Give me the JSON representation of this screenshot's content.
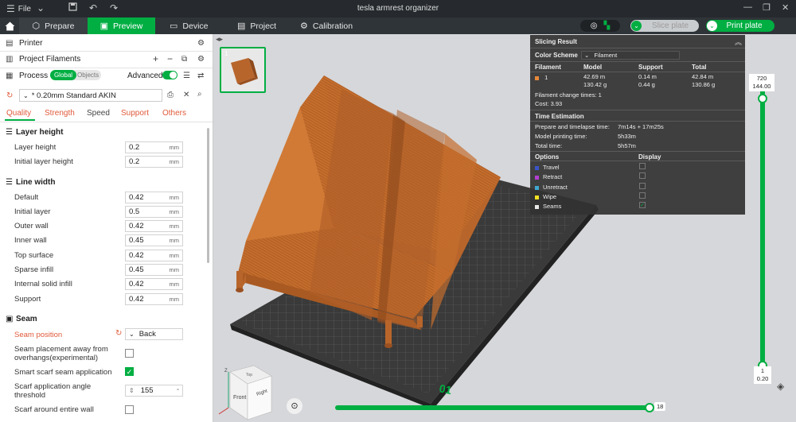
{
  "window": {
    "title": "tesla armrest organizer",
    "menu_label": "File"
  },
  "nav": {
    "tabs": [
      {
        "label": "Prepare"
      },
      {
        "label": "Preview"
      },
      {
        "label": "Device"
      },
      {
        "label": "Project"
      },
      {
        "label": "Calibration"
      }
    ],
    "slice_plate": "Slice plate",
    "print_plate": "Print plate"
  },
  "left": {
    "printer_label": "Printer",
    "project_filaments_label": "Project Filaments",
    "process_label": "Process",
    "global_label": "Global",
    "objects_label": "Objects",
    "advanced_label": "Advanced",
    "profile_name": "* 0.20mm Standard AKIN",
    "tabs": [
      "Quality",
      "Strength",
      "Speed",
      "Support",
      "Others"
    ],
    "layer_height": {
      "title": "Layer height",
      "rows": [
        {
          "label": "Layer height",
          "value": "0.2",
          "unit": "mm"
        },
        {
          "label": "Initial layer height",
          "value": "0.2",
          "unit": "mm"
        }
      ]
    },
    "line_width": {
      "title": "Line width",
      "rows": [
        {
          "label": "Default",
          "value": "0.42",
          "unit": "mm"
        },
        {
          "label": "Initial layer",
          "value": "0.5",
          "unit": "mm"
        },
        {
          "label": "Outer wall",
          "value": "0.42",
          "unit": "mm"
        },
        {
          "label": "Inner wall",
          "value": "0.45",
          "unit": "mm"
        },
        {
          "label": "Top surface",
          "value": "0.42",
          "unit": "mm"
        },
        {
          "label": "Sparse infill",
          "value": "0.45",
          "unit": "mm"
        },
        {
          "label": "Internal solid infill",
          "value": "0.42",
          "unit": "mm"
        },
        {
          "label": "Support",
          "value": "0.42",
          "unit": "mm"
        }
      ]
    },
    "seam": {
      "title": "Seam",
      "seam_position_label": "Seam position",
      "seam_position_value": "Back",
      "away_label_1": "Seam placement away from",
      "away_label_2": "overhangs(experimental)",
      "smart_scarf_label": "Smart scarf seam application",
      "scarf_angle_label_1": "Scarf application angle",
      "scarf_angle_label_2": "threshold",
      "scarf_angle_value": "155",
      "scarf_angle_unit": "°",
      "scarf_entire_label": "Scarf around entire wall"
    }
  },
  "plate": {
    "number": "1",
    "bed_label": "01"
  },
  "result": {
    "title": "Slicing Result",
    "color_scheme_label": "Color Scheme",
    "color_scheme_value": "Filament",
    "headers": {
      "filament": "Filament",
      "model": "Model",
      "support": "Support",
      "total": "Total"
    },
    "filament_row": {
      "index": "1",
      "model_1": "42.69 m",
      "model_2": "130.42 g",
      "support_1": "0.14 m",
      "support_2": "0.44 g",
      "total_1": "42.84 m",
      "total_2": "130.86 g",
      "color": "#e8893a"
    },
    "change_times": "Filament change times:  1",
    "cost": "Cost:  3.93",
    "time_title": "Time Estimation",
    "prep_label": "Prepare and timelapse time:",
    "prep_value": "7m14s + 17m25s",
    "model_time_label": "Model printing time:",
    "model_time_value": "5h33m",
    "total_time_label": "Total time:",
    "total_time_value": "5h57m",
    "options_label": "Options",
    "display_label": "Display",
    "options": [
      {
        "label": "Travel",
        "color": "#3a55c8",
        "checked": false
      },
      {
        "label": "Retract",
        "color": "#b23fd0",
        "checked": false
      },
      {
        "label": "Unretract",
        "color": "#3fa8d0",
        "checked": false
      },
      {
        "label": "Wipe",
        "color": "#f0e020",
        "checked": false
      },
      {
        "label": "Seams",
        "color": "#e6e6e6",
        "checked": true
      }
    ]
  },
  "layer_slider": {
    "top_layer": "720",
    "top_height": "144.00",
    "bottom_layer": "1",
    "bottom_height": "0.20"
  },
  "move_slider": {
    "value": "18"
  },
  "cube": {
    "front": "Front",
    "right": "Right",
    "top": "Top"
  },
  "colors": {
    "accent": "#00ae42",
    "model": "#c56d2d",
    "topbar": "#262a2e",
    "navbar": "#2f3438"
  }
}
